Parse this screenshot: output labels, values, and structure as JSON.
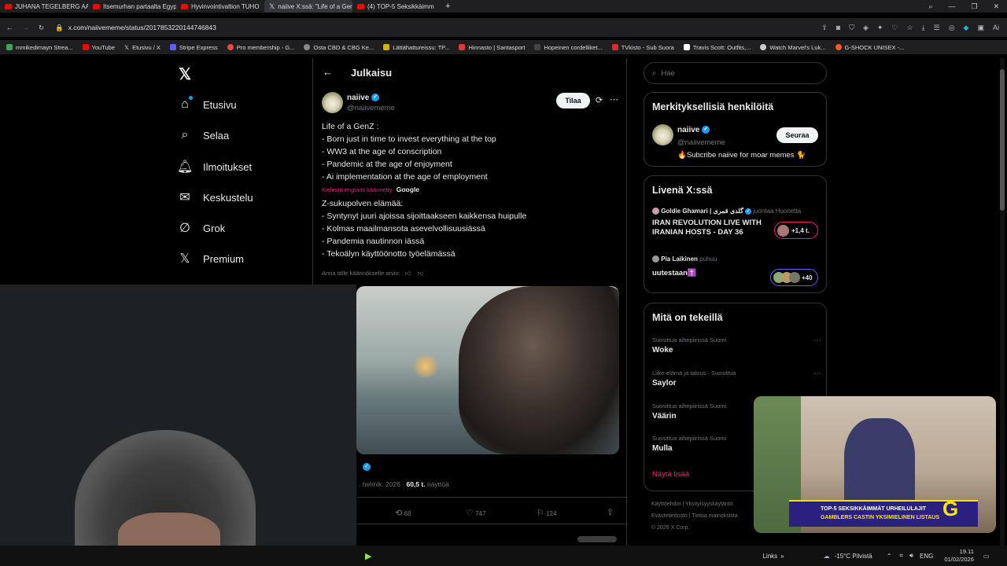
{
  "browser": {
    "tabs": [
      {
        "label": "JUHANA TEGELBERG AAS"
      },
      {
        "label": "Itsemurhan partaalta Egyp"
      },
      {
        "label": "Hyvinvointivaltion TUHO"
      },
      {
        "label": "naiive X:ssä: \"Life of a Gen"
      },
      {
        "label": "(4) TOP-5 Seksikkäimm"
      }
    ],
    "url": "x.com/naiivememe/status/2017853220144746843",
    "bookmarks": [
      {
        "label": "mmikedimayn Strea...",
        "color": "#3aa757"
      },
      {
        "label": "YouTube",
        "color": "#ff0000"
      },
      {
        "label": "Etusivu / X",
        "color": "#ffffff"
      },
      {
        "label": "Stripe Express",
        "color": "#635bff"
      },
      {
        "label": "Pro membership - G...",
        "color": "#e84c3d"
      },
      {
        "label": "Osta CBD & CBG Ke...",
        "color": "#888888"
      },
      {
        "label": "Lättähattureissu: TP...",
        "color": "#d6b100"
      },
      {
        "label": "Hinnasto | Santasport",
        "color": "#e53935"
      },
      {
        "label": "Hopeinen cordelliket...",
        "color": "#444444"
      },
      {
        "label": "TVkisto - Sub Suora",
        "color": "#d32f2f"
      },
      {
        "label": "Travis Scott: Outfits,...",
        "color": "#ffffff"
      },
      {
        "label": "Watch Marvel's Luk...",
        "color": "#cccccc"
      },
      {
        "label": "G-SHOCK UNISEX -...",
        "color": "#ff5722"
      }
    ]
  },
  "nav": {
    "items": [
      {
        "label": "Etusivu",
        "icon": "home-icon"
      },
      {
        "label": "Selaa",
        "icon": "search-icon"
      },
      {
        "label": "Ilmoitukset",
        "icon": "bell-icon"
      },
      {
        "label": "Keskustelu",
        "icon": "mail-icon"
      },
      {
        "label": "Grok",
        "icon": "grok-icon"
      },
      {
        "label": "Premium",
        "icon": "x-logo-icon"
      }
    ]
  },
  "post": {
    "header_title": "Julkaisu",
    "author_name": "naiive",
    "author_handle": "@naiivememe",
    "subscribe_label": "Tilaa",
    "original_text": [
      "Life of a GenZ :",
      "- Born just in time to invest everything at the top",
      "- WW3 at the age of conscription",
      "- Pandemic at the age of enjoyment",
      "- Ai implementation at the age of employment"
    ],
    "translated_notice": "Kielestä englanti käännetty",
    "translated_by": "Google",
    "translated_text": [
      "Z-sukupolven elämää:",
      "- Syntynyt juuri ajoissa sijoittaakseen kaikkensa huipulle",
      "- Kolmas maailmansota asevelvollisuusiässä",
      "- Pandemia nautinnon iässä",
      "- Tekoälyn käyttöönotto työelämässä"
    ],
    "rate_translation": "Anna tälle käännökselle arvio:",
    "date_fragment": ". helmik. 2026",
    "views_value": "60,5 t.",
    "views_label": "näyttöä",
    "reposts": "68",
    "likes": "747",
    "bookmarks": "124"
  },
  "sidebar": {
    "search_placeholder": "Hae",
    "relevant": {
      "title": "Merkityksellisiä henkilöitä",
      "name": "naiive",
      "handle": "@naiivememe",
      "bio": "🔥Subcribe naiive for moar memes 🐈",
      "follow_label": "Seuraa"
    },
    "live": {
      "title": "Livenä X:ssä",
      "items": [
        {
          "host": "Goldie Ghamari | گلدی قمری",
          "status": "juontaa Huonetta",
          "title": "IRAN REVOLUTION LIVE WITH IRANIAN HOSTS - DAY 36",
          "count": "+1,4 t."
        },
        {
          "host": "Pia Laikinen",
          "status": "puhuu",
          "title": "uutestaan✝️",
          "count": "+40"
        }
      ]
    },
    "trends": {
      "title": "Mitä on tekeillä",
      "items": [
        {
          "meta": "Suosittua aihepiirissä Suomi",
          "name": "Woke"
        },
        {
          "meta": "Liike-elämä ja talous · Suosittua",
          "name": "Saylor"
        },
        {
          "meta": "Suosittua aihepiirissä Suomi",
          "name": "Väärin"
        },
        {
          "meta": "Suosittua aihepiirissä Suomi",
          "name": "Mulla"
        }
      ],
      "show_more": "Näytä lisää"
    },
    "footer": [
      "Käyttöehdot",
      "Yksityisyyskäytäntö",
      "Evästetiedosto",
      "Tietoa mainoksista",
      "© 2026 X Corp."
    ]
  },
  "pip": {
    "banner_line1": "TOP-5 SEKSIKKÄIMMÄT URHEILULAJIT",
    "banner_line2": "GAMBLERS CASTIN YKSIMIELINEN LISTAUS"
  },
  "taskbar": {
    "links": "Links",
    "weather": "-15°C Pilvistä",
    "lang": "ENG",
    "time": "19.11",
    "date": "01/02/2026"
  },
  "colors": {
    "accent": "#1d9bf0",
    "pink": "#f91880",
    "bg": "#000000"
  }
}
